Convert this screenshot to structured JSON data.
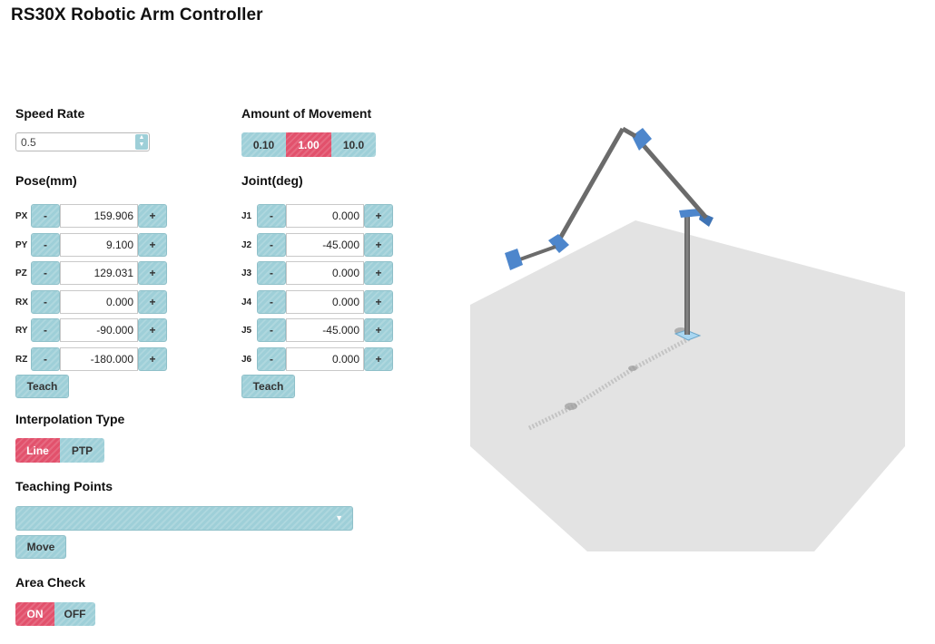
{
  "app": {
    "title": "RS30X Robotic Arm Controller"
  },
  "speed": {
    "label": "Speed Rate",
    "value": "0.5"
  },
  "movement": {
    "label": "Amount of Movement",
    "options": [
      "0.10",
      "1.00",
      "10.0"
    ],
    "selected": "1.00"
  },
  "pose": {
    "label": "Pose(mm)",
    "minus": "-",
    "plus": "+",
    "teach_label": "Teach",
    "rows": [
      {
        "name": "PX",
        "value": "159.906"
      },
      {
        "name": "PY",
        "value": "9.100"
      },
      {
        "name": "PZ",
        "value": "129.031"
      },
      {
        "name": "RX",
        "value": "0.000"
      },
      {
        "name": "RY",
        "value": "-90.000"
      },
      {
        "name": "RZ",
        "value": "-180.000"
      }
    ]
  },
  "joint": {
    "label": "Joint(deg)",
    "minus": "-",
    "plus": "+",
    "teach_label": "Teach",
    "rows": [
      {
        "name": "J1",
        "value": "0.000"
      },
      {
        "name": "J2",
        "value": "-45.000"
      },
      {
        "name": "J3",
        "value": "0.000"
      },
      {
        "name": "J4",
        "value": "0.000"
      },
      {
        "name": "J5",
        "value": "-45.000"
      },
      {
        "name": "J6",
        "value": "0.000"
      }
    ]
  },
  "interpolation": {
    "label": "Interpolation Type",
    "options": [
      "Line",
      "PTP"
    ],
    "selected": "Line"
  },
  "teaching": {
    "label": "Teaching Points",
    "selected_value": "",
    "move_label": "Move"
  },
  "area_check": {
    "label": "Area Check",
    "options": [
      "ON",
      "OFF"
    ],
    "selected": "ON"
  },
  "colors": {
    "accent_teal": "#9ecfd8",
    "active_red": "#e2516c",
    "floor": "#e3e3e3",
    "arm_link": "#6b6b6b",
    "servo_blue": "#4d86cc"
  },
  "icons": {
    "spinner": "up-down-arrows-icon",
    "dropdown": "chevron-down-icon"
  }
}
